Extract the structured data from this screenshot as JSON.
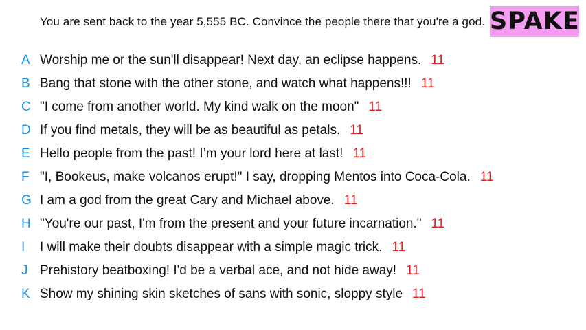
{
  "prompt": "You are sent back to the year 5,555 BC. Convince the people there that you're a god.",
  "brand": "SPAKE",
  "colors": {
    "letter": "#1e8fe0",
    "score": "#e21b1b",
    "brand_bg": "#f49bf2"
  },
  "answers": [
    {
      "letter": "A",
      "text": "Worship me or the sun'll disappear! Next day, an eclipse happens.",
      "score": "11"
    },
    {
      "letter": "B",
      "text": "Bang that stone with the other stone, and watch what happens!!!",
      "score": "11"
    },
    {
      "letter": "C",
      "text": "\"I come from another world. My kind walk on the moon\"",
      "score": "11"
    },
    {
      "letter": "D",
      "text": "If you find metals, they will be as beautiful as petals.",
      "score": "11"
    },
    {
      "letter": "E",
      "text": "Hello people from the past! I’m your lord here at last!",
      "score": "11"
    },
    {
      "letter": "F",
      "text": "\"I, Bookeus, make volcanos erupt!\" I say, dropping Mentos into Coca-Cola.",
      "score": "11"
    },
    {
      "letter": "G",
      "text": "I am a god from the great Cary and Michael above.",
      "score": "11"
    },
    {
      "letter": "H",
      "text": "\"You're our past, I'm from the present and your future incarnation.\"",
      "score": "11"
    },
    {
      "letter": "I",
      "text": "I will make their doubts disappear with a simple magic trick.",
      "score": "11"
    },
    {
      "letter": "J",
      "text": "Prehistory beatboxing! I'd be a verbal ace, and not hide away!",
      "score": "11"
    },
    {
      "letter": "K",
      "text": "Show my shining skin sketches of sans with sonic, sloppy style",
      "score": "11"
    }
  ]
}
